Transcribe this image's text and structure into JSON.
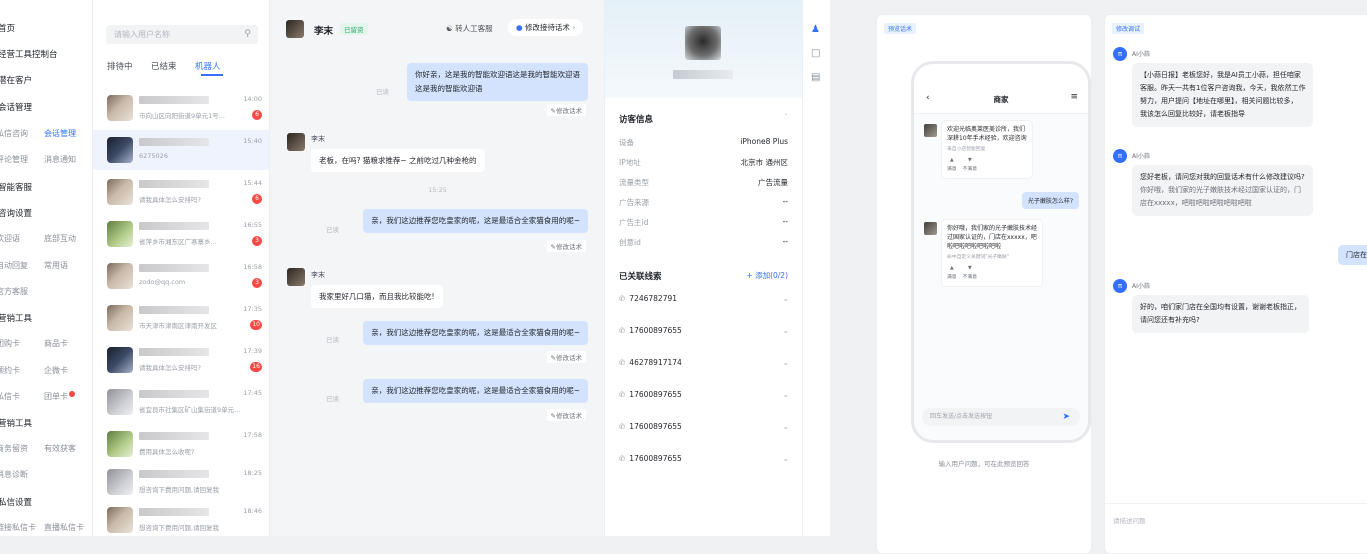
{
  "sidebar": {
    "items": [
      {
        "label": "首页"
      },
      {
        "label": "经营工具控制台"
      },
      {
        "label": "潜在客户"
      },
      {
        "label": "会话管理"
      },
      {
        "label": "私信咨询"
      },
      {
        "label": "会话管理"
      },
      {
        "label": "评论管理"
      },
      {
        "label": "消息通知"
      },
      {
        "label": "智能客服"
      },
      {
        "label": "咨询设置"
      },
      {
        "label": "欢迎语"
      },
      {
        "label": "底部互动"
      },
      {
        "label": "自动回复"
      },
      {
        "label": "常用语"
      },
      {
        "label": "官方客服"
      },
      {
        "label": "营销工具"
      },
      {
        "label": "团购卡"
      },
      {
        "label": "商品卡"
      },
      {
        "label": "预约卡"
      },
      {
        "label": "企微卡"
      },
      {
        "label": "私信卡"
      },
      {
        "label": "团单卡"
      },
      {
        "label": "营销工具"
      },
      {
        "label": "商务留资"
      },
      {
        "label": "有效获客"
      },
      {
        "label": "消息诊断"
      },
      {
        "label": "私信设置"
      },
      {
        "label": "链接私信卡"
      },
      {
        "label": "直播私信卡"
      }
    ]
  },
  "list": {
    "search_placeholder": "请输入用户名称",
    "tabs": [
      {
        "label": "排待中"
      },
      {
        "label": "已结束"
      },
      {
        "label": "机器人"
      }
    ],
    "rows": [
      {
        "preview": "市向山区向阳街道9单元1号...",
        "time": "14:00",
        "count": "6"
      },
      {
        "preview": "6275026",
        "time": "15:40",
        "count": ""
      },
      {
        "preview": "请我具体怎么安排吗?",
        "time": "15:44",
        "count": "6"
      },
      {
        "preview": "省萍乡市湘东区广寒寨乡...",
        "time": "16:55",
        "count": "3"
      },
      {
        "preview": "zodo@qq.com",
        "time": "16:58",
        "count": "3"
      },
      {
        "preview": "市天津市津南区津南开发区",
        "time": "17:35",
        "count": "10"
      },
      {
        "preview": "请我具体怎么安排吗?",
        "time": "17:39",
        "count": "16"
      },
      {
        "preview": "省宜良市社集区矿山集街道9单元...",
        "time": "17:45",
        "count": ""
      },
      {
        "preview": "费用具体怎么收呢?",
        "time": "17:58",
        "count": ""
      },
      {
        "preview": "想咨询下费用问题,请回复我",
        "time": "18:25",
        "count": ""
      },
      {
        "preview": "想咨询下费用问题,请回复我",
        "time": "18:46",
        "count": ""
      }
    ]
  },
  "chat": {
    "name": "李末",
    "tag": "已留资",
    "transfer": "转人工客服",
    "modify": "修改接待话术",
    "user_name": "李末",
    "read": "已读",
    "edit": "修改话术",
    "bot1": "你好亲，这是我的智能欢迎语这是我的智能欢迎语\n这是我的智能欢迎语",
    "user1": "老板，在吗? 猫粮求推荐~ 之前吃过几种金枪的",
    "time_sep": "15:25",
    "bot2": "亲，我们这边推荐您吃皇家的呢，这是最适合全家猫食用的呢~",
    "user2": "我家里好几口猫，而且我比较能吃!",
    "bot3": "亲，我们这边推荐您吃皇家的呢，这是最适合全家猫食用的呢~",
    "bot4": "亲，我们这边推荐您吃皇家的呢，这是最适合全家猫食用的呢~"
  },
  "info": {
    "visitor_title": "访客信息",
    "fields": [
      {
        "label": "设备",
        "value": "iPhone8 Plus"
      },
      {
        "label": "IP地址",
        "value": "北京市 通州区"
      },
      {
        "label": "流量类型",
        "value": "广告流量"
      },
      {
        "label": "广告来源",
        "value": "--"
      },
      {
        "label": "广告主id",
        "value": "--"
      },
      {
        "label": "创意id",
        "value": "--"
      }
    ],
    "leads_title": "已关联线索",
    "add_label": "+ 添加(0/2)",
    "leads": [
      "7246782791",
      "17600897655",
      "46278917174",
      "17600897655",
      "17600897655",
      "17600897655"
    ]
  },
  "preview": {
    "tag": "预览话术",
    "phone_title": "商家",
    "m1": "欢迎光临奥莱医美诊所，我们\n深耕10年手术经验，欢迎咨询",
    "m1_note": "来自小店智能回复",
    "m2": "光子嫩肤怎么样?",
    "m3": "你好哦，我们家的光子嫩肤技术经\n过国家认证的，门店在xxxxx，吧\n啦吧啦吧啦吧啦吧啦",
    "m3_note": "命中自定义关键词\"光子嫩肤\"",
    "like": "满意",
    "dislike": "不满意",
    "input_placeholder": "回车发送/点击发送按钮",
    "caption": "输入用户问题，可在此预览回答"
  },
  "debug": {
    "tag": "修改调试",
    "ai_name": "AI小蒜",
    "a1": "【小蒜日报】老板您好，我是AI员工小蒜，担任咱家\n客服。昨天一共有1位客户咨询我，今天，我依然工作\n努力，用户提问【地址在哪里】，相关问题比较多，\n我该怎么回复比较好，请老板指导",
    "a2a": "您好老板，请问您对我的回复话术有什么修改建议吗?",
    "a2b": "你好哦，我们家的光子嫩肤技术经过国家认证的，门\n店在xxxxx，吧啦吧啦吧啦吧啦吧啦",
    "u1": "门店在全国均有设置",
    "a3": "好的，咱们家门店在全国均有设置，谢谢老板指正，\n请问您还有补充吗?",
    "input_placeholder": "请描述问题"
  }
}
